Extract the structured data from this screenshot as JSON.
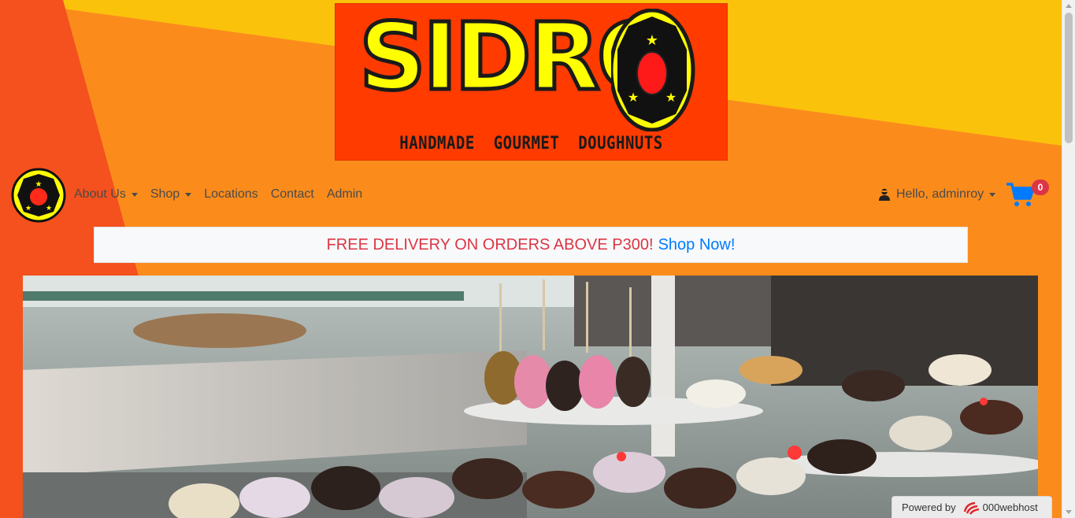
{
  "banner": {
    "brand": "SIDRO",
    "tagline": "HANDMADE GOURMET DOUGHNUTS",
    "colors": {
      "background": "#ff3b00",
      "letters": "#ffff00",
      "outline": "#1a1a1a"
    }
  },
  "nav": {
    "logo_icon": "sidro-emblem-icon",
    "links": [
      {
        "label": "About Us",
        "dropdown": true
      },
      {
        "label": "Shop",
        "dropdown": true
      },
      {
        "label": "Locations",
        "dropdown": false
      },
      {
        "label": "Contact",
        "dropdown": false
      },
      {
        "label": "Admin",
        "dropdown": false
      }
    ],
    "user": {
      "icon": "user-icon",
      "greeting": "Hello, adminroy"
    },
    "cart": {
      "icon": "shopping-cart-icon",
      "count": "0"
    }
  },
  "promo": {
    "text": "FREE DELIVERY ON ORDERS ABOVE P300!",
    "link": "Shop Now!"
  },
  "hero": {
    "image": "doughnut-display-photo"
  },
  "footer_badge": {
    "label": "Powered by",
    "brand": "000webhost"
  },
  "colors": {
    "accent_yellow": "#fbc20c",
    "accent_orange": "#fb8c1c",
    "accent_red": "#f4511e",
    "promo_red": "#dc3545",
    "link_blue": "#007bff"
  }
}
